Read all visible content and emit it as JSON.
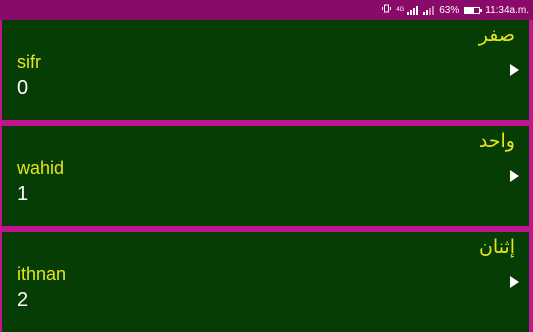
{
  "status_bar": {
    "network": "4G",
    "battery": "63%",
    "battery_level": 0.63,
    "time": "11:34a.m.",
    "icons": [
      "vibrate-icon",
      "network-4g-icon",
      "signal-icon",
      "signal-icon",
      "battery-icon"
    ]
  },
  "colors": {
    "status_bar": "#8a0a6a",
    "divider": "#c2148e",
    "card_background": "#053d05",
    "arabic_text": "#e6e41c",
    "transliteration_text": "#e6e41c",
    "number_text": "#ffffff"
  },
  "numbers": [
    {
      "arabic": "صفر",
      "transliteration": "sifr",
      "digit": "0"
    },
    {
      "arabic": "واحد",
      "transliteration": "wahid",
      "digit": "1"
    },
    {
      "arabic": "إثنان",
      "transliteration": "ithnan",
      "digit": "2"
    }
  ]
}
